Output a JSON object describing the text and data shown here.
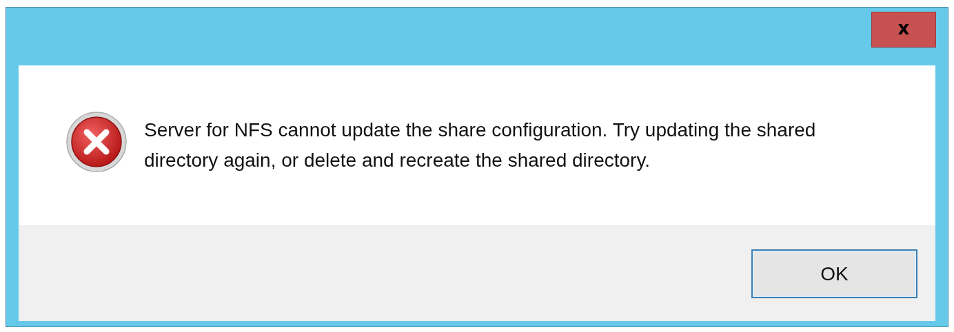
{
  "window": {
    "close_label": "x"
  },
  "message": "Server for NFS cannot update the share configuration. Try updating the shared directory again, or delete and recreate the shared directory.",
  "icon": {
    "kind": "error"
  },
  "buttons": [
    {
      "label": "OK",
      "selected": true
    }
  ]
}
